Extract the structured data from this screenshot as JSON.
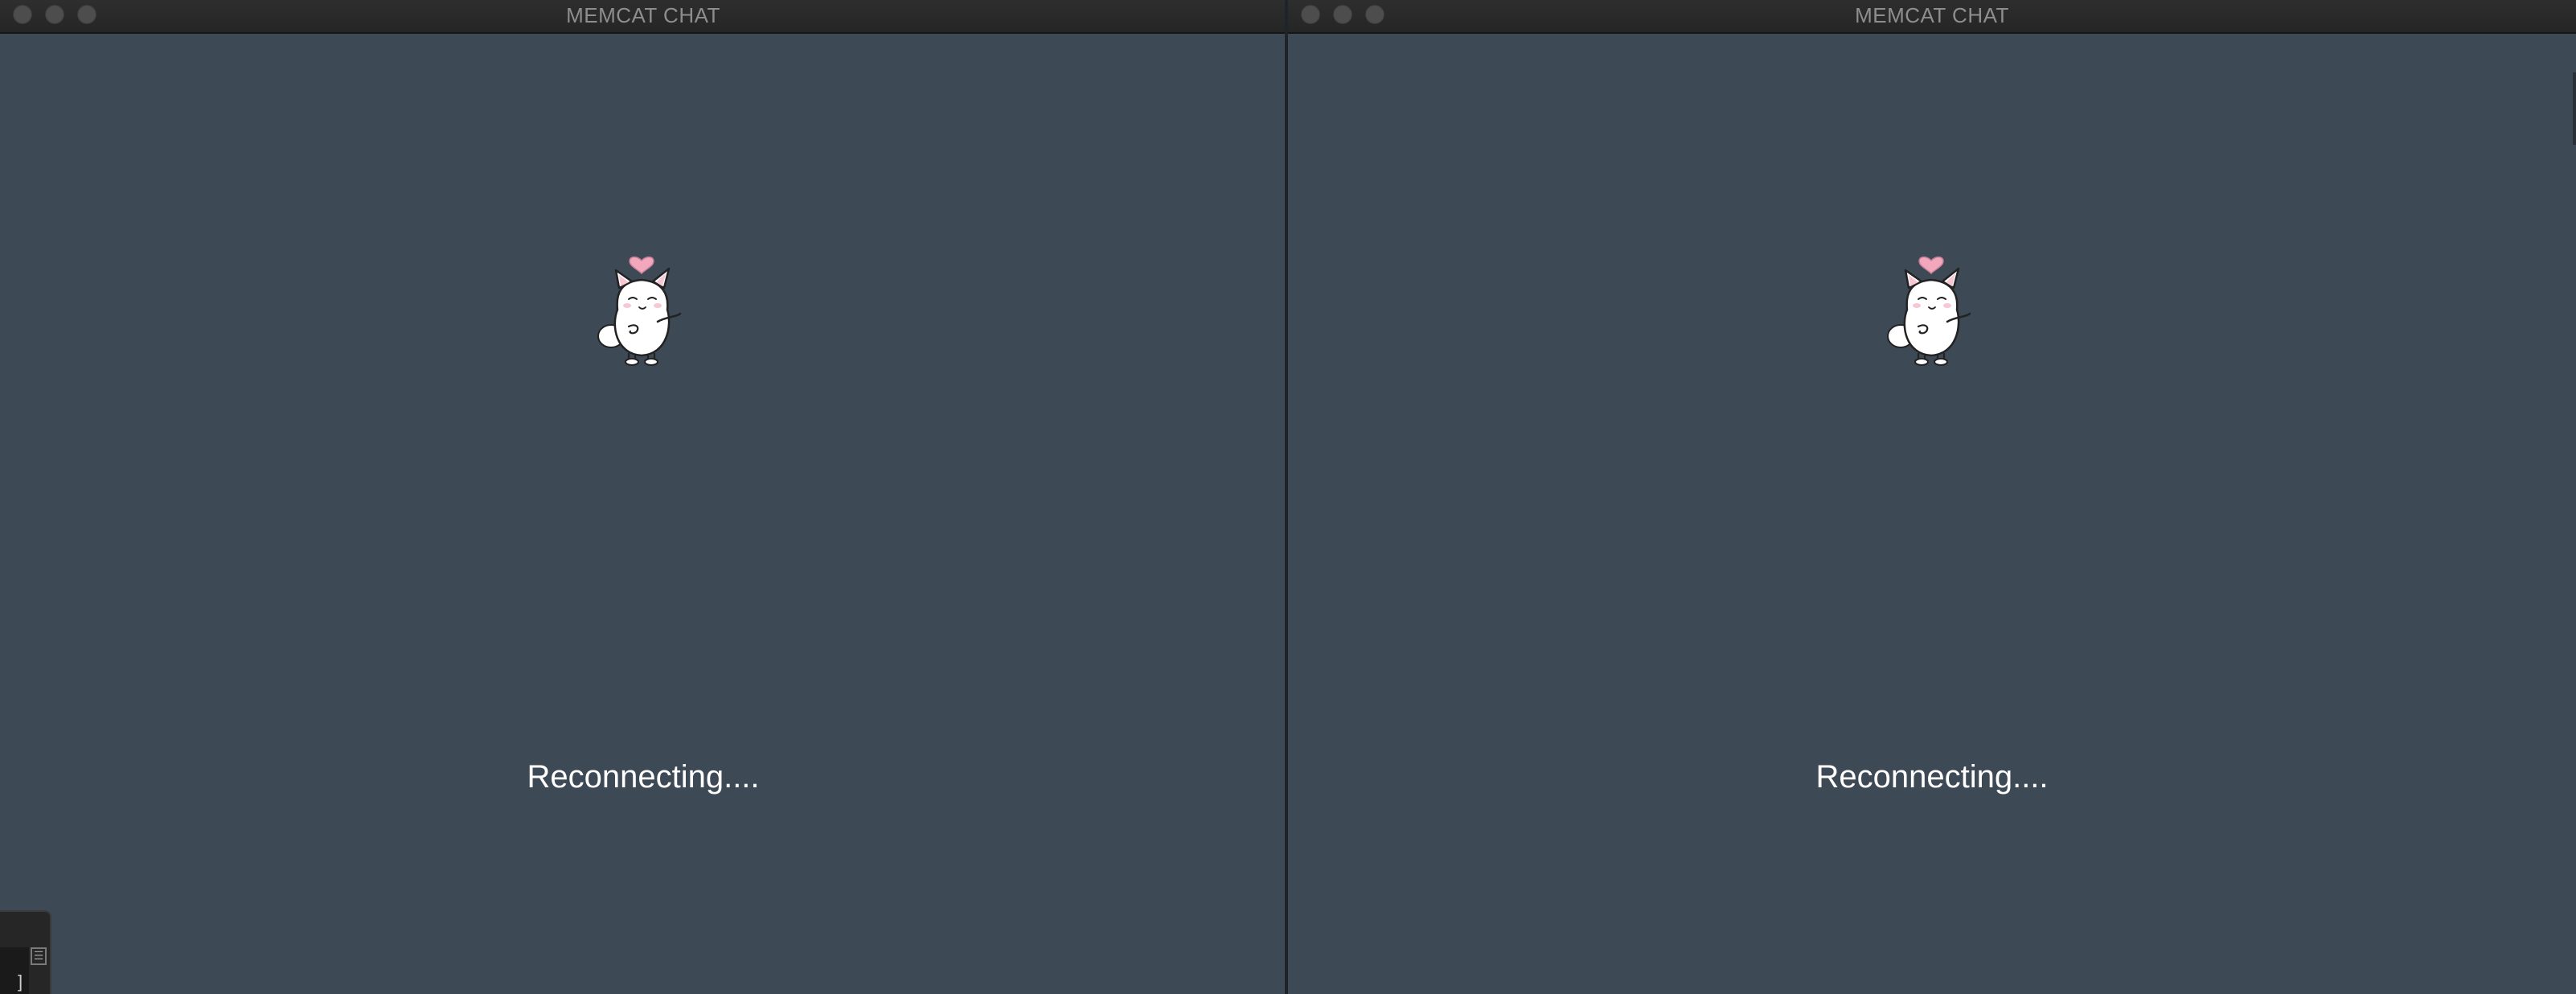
{
  "windows": [
    {
      "title": "MEMCAT CHAT",
      "status": "Reconnecting...."
    },
    {
      "title": "MEMCAT CHAT",
      "status": "Reconnecting...."
    }
  ],
  "colors": {
    "background": "#3e4956",
    "titlebar": "#2b2b2b",
    "heart": "#f2a7bd"
  },
  "icons": {
    "mascot": "cat-mascot-icon",
    "heart": "heart-icon"
  }
}
